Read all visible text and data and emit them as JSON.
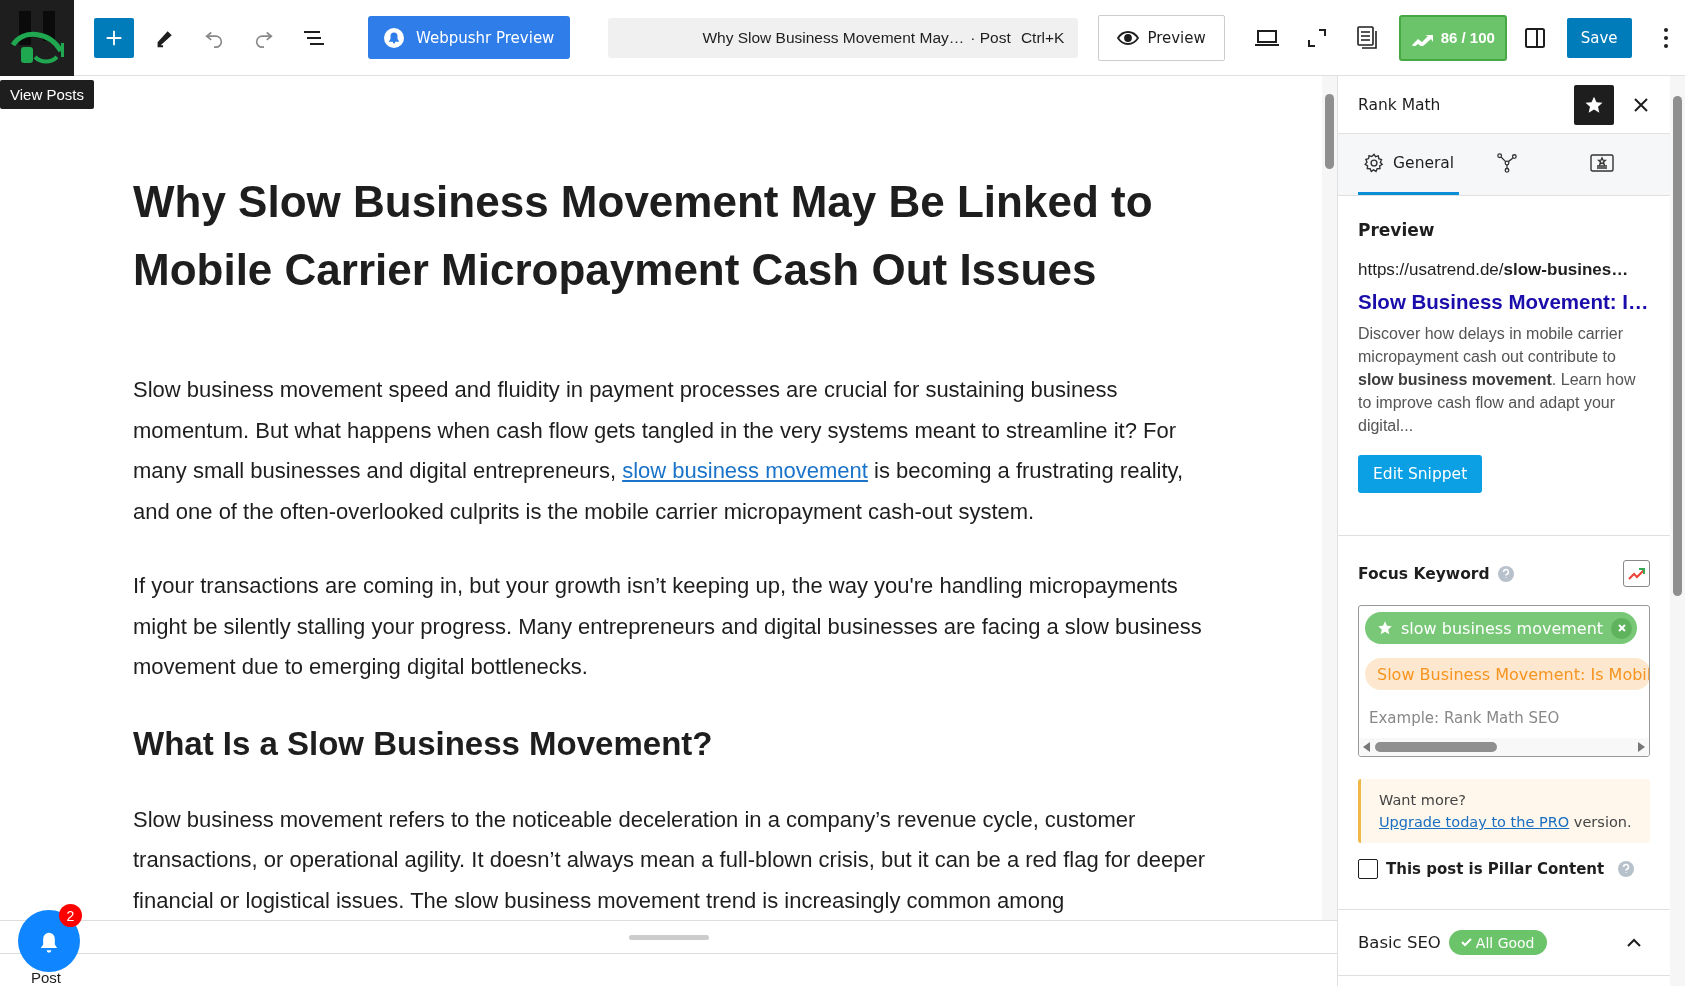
{
  "toolbar": {
    "logo_tooltip": "View Posts",
    "webpushr_button": "Webpushr Preview",
    "command_bar": {
      "title": "Why Slow Business Movement May…",
      "type": "· Post",
      "shortcut": "Ctrl+K"
    },
    "preview_button": "Preview",
    "seo_score": "86 / 100",
    "save_button": "Save"
  },
  "editor": {
    "title": "Why Slow Business Movement May Be Linked to Mobile Carrier Micropayment Cash Out Issues",
    "blocks": [
      {
        "kind": "linked_paragraph",
        "before": "Slow business movement speed and fluidity in payment processes are crucial for sustaining business momentum. But what happens when cash flow gets tangled in the very systems meant to streamline it? For many small businesses and digital entrepreneurs, ",
        "link": "slow business movement",
        "after": " is becoming a frustrating reality, and one of the often-overlooked culprits is the mobile carrier micropayment cash-out system."
      },
      {
        "kind": "paragraph",
        "text": "If your transactions are coming in, but your growth isn’t keeping up, the way you're handling micropayments might be silently stalling your progress. Many entrepreneurs and digital businesses are facing a slow business movement due to emerging digital bottlenecks."
      },
      {
        "kind": "heading",
        "text": "What Is a Slow Business Movement?"
      },
      {
        "kind": "paragraph",
        "text": "Slow business movement refers to the noticeable deceleration in a company’s revenue cycle, customer transactions, or operational agility. It doesn’t always mean a full-blown crisis, but it can be a red flag for deeper financial or logistical issues. The slow business movement trend is increasingly common among"
      }
    ]
  },
  "sidebar": {
    "title": "Rank Math",
    "tabs": [
      {
        "kind": "settings",
        "label": "General",
        "selected": true
      },
      {
        "kind": "schema",
        "selected": false
      },
      {
        "kind": "social",
        "selected": false
      }
    ],
    "preview": {
      "heading": "Preview",
      "url": "https://usatrend.de/**slow-busines…**",
      "title": "Slow Business Movement: I…",
      "description": "Discover how delays in mobile carrier micropayment cash out contribute to **slow business movement**. Learn how to improve cash flow and adapt your digital...",
      "button": "Edit Snippet"
    },
    "focus_keyword": {
      "label": "Focus Keyword",
      "keywords": [
        {
          "kind": "primary",
          "text": "slow business movement"
        },
        {
          "kind": "suggestion",
          "text": "Slow Business Movement: Is Mobil"
        }
      ],
      "placeholder": "Example: Rank Math SEO"
    },
    "notice": {
      "before": "Want more?",
      "link": "Upgrade today to the PRO",
      "after": "version."
    },
    "pillar": {
      "label": "This post is Pillar Content",
      "checked": false
    },
    "basic_seo": {
      "label": "Basic SEO",
      "status": "All Good",
      "expanded": true
    }
  },
  "footer": {
    "breadcrumb": "Post",
    "notification_count": "2"
  }
}
